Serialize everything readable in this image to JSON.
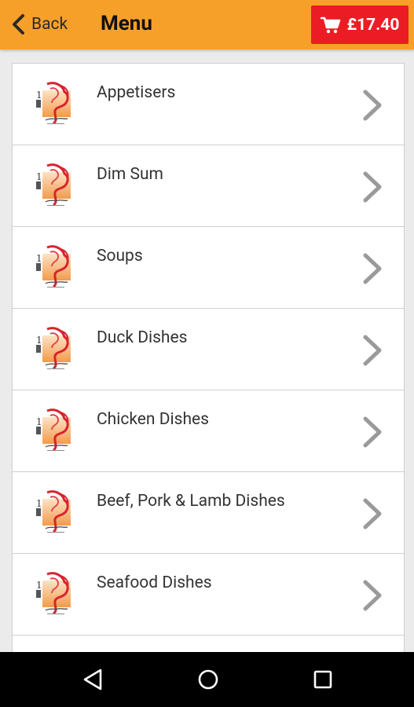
{
  "header": {
    "back_label": "Back",
    "title": "Menu",
    "cart_total": "£17.40",
    "colors": {
      "bar": "#f7a029",
      "cart": "#ec1c24"
    }
  },
  "categories": [
    {
      "label": "Appetisers"
    },
    {
      "label": "Dim Sum"
    },
    {
      "label": "Soups"
    },
    {
      "label": "Duck Dishes"
    },
    {
      "label": "Chicken Dishes"
    },
    {
      "label": "Beef, Pork & Lamb Dishes"
    },
    {
      "label": "Seafood Dishes"
    },
    {
      "label": ""
    }
  ],
  "icons": {
    "back": "chevron-left-icon",
    "cart": "cart-icon",
    "row_logo": "restaurant-logo-icon",
    "row_chevron": "chevron-right-icon",
    "nav_back": "nav-back-icon",
    "nav_home": "nav-home-icon",
    "nav_recents": "nav-recents-icon"
  }
}
